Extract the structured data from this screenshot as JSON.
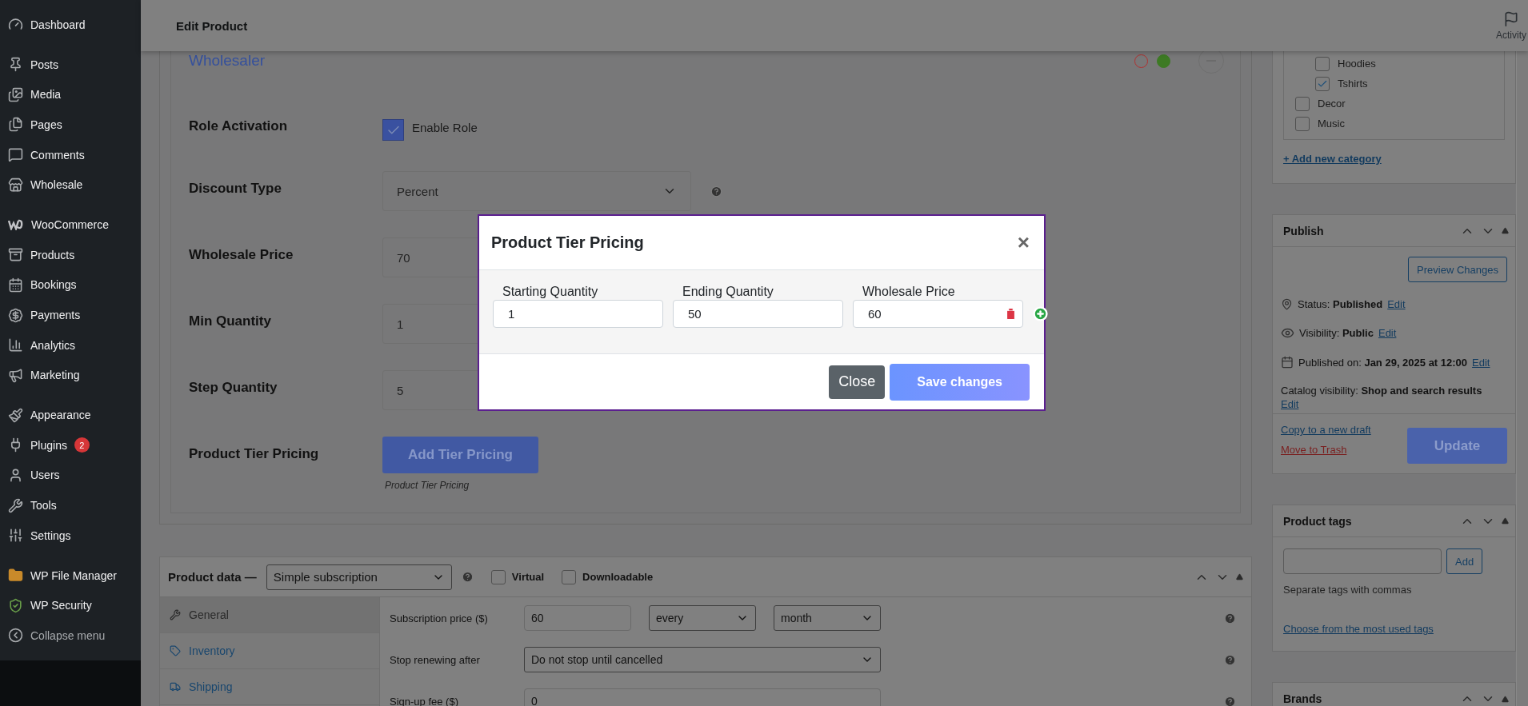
{
  "sidebar": {
    "groups": [
      {
        "items": [
          {
            "label": "Dashboard",
            "kind": "dashboard"
          }
        ]
      },
      {
        "items": [
          {
            "label": "Posts",
            "kind": "posts"
          },
          {
            "label": "Media",
            "kind": "media"
          },
          {
            "label": "Pages",
            "kind": "pages"
          },
          {
            "label": "Comments",
            "kind": "comments"
          },
          {
            "label": "Wholesale",
            "kind": "store"
          }
        ]
      },
      {
        "items": [
          {
            "label": "WooCommerce",
            "kind": "woo"
          },
          {
            "label": "Products",
            "kind": "products"
          },
          {
            "label": "Bookings",
            "kind": "bookings"
          },
          {
            "label": "Payments",
            "kind": "payments"
          },
          {
            "label": "Analytics",
            "kind": "analytics"
          },
          {
            "label": "Marketing",
            "kind": "marketing"
          }
        ]
      },
      {
        "items": [
          {
            "label": "Appearance",
            "kind": "appearance"
          },
          {
            "label": "Plugins",
            "kind": "plugins",
            "badge": "2"
          },
          {
            "label": "Users",
            "kind": "users"
          },
          {
            "label": "Tools",
            "kind": "tools"
          },
          {
            "label": "Settings",
            "kind": "settings"
          }
        ]
      },
      {
        "items": [
          {
            "label": "WP File Manager",
            "kind": "folder"
          },
          {
            "label": "WP Security",
            "kind": "shield"
          },
          {
            "label": "Collapse menu",
            "kind": "collapse"
          }
        ]
      }
    ]
  },
  "header": {
    "title": "Edit Product",
    "activity": "Activity"
  },
  "role_panel": {
    "title": "Wholesaler",
    "status_dots": [
      {
        "color": "#b03030",
        "filled": false
      },
      {
        "color": "#3d7a24",
        "filled": true
      }
    ],
    "rows": [
      {
        "label": "Role Activation",
        "kind": "checkbox",
        "checked": true,
        "text": "Enable Role"
      },
      {
        "label": "Discount Type",
        "kind": "select",
        "value": "Percent",
        "help": true
      },
      {
        "label": "Wholesale Price",
        "kind": "input",
        "value": "70"
      },
      {
        "label": "Min Quantity",
        "kind": "input",
        "value": "1"
      },
      {
        "label": "Step Quantity",
        "kind": "input",
        "value": "5"
      },
      {
        "label": "Product Tier Pricing",
        "kind": "button",
        "text": "Add Tier Pricing",
        "note": "Product Tier Pricing"
      }
    ]
  },
  "modal": {
    "title": "Product Tier Pricing",
    "close": "×",
    "columns": [
      "Starting Quantity",
      "Ending Quantity",
      "Wholesale Price"
    ],
    "tiers": [
      {
        "start": "1",
        "end": "50",
        "price": "60"
      }
    ],
    "buttons": [
      {
        "label": "Close",
        "kind": "secondary"
      },
      {
        "label": "Save changes",
        "kind": "primary"
      }
    ]
  },
  "product_data": {
    "label": "Product data —",
    "type": "Simple subscription",
    "options": [
      {
        "label": "Virtual",
        "checked": false
      },
      {
        "label": "Downloadable",
        "checked": false
      }
    ],
    "tabs": [
      {
        "label": "General",
        "selected": true,
        "kind": "wrench"
      },
      {
        "label": "Inventory",
        "selected": false,
        "kind": "tag"
      },
      {
        "label": "Shipping",
        "selected": false,
        "kind": "truck"
      }
    ],
    "fields": [
      {
        "label": "Subscription price ($)",
        "kind": "price",
        "value": "60",
        "period": "every",
        "interval": "month"
      },
      {
        "label": "Stop renewing after",
        "kind": "select",
        "value": "Do not stop until cancelled"
      },
      {
        "label": "Sign-up fee ($)",
        "kind": "input",
        "value": "0"
      }
    ]
  },
  "categories": {
    "items": [
      {
        "children": [
          {
            "label": "Hoodies",
            "checked": false
          },
          {
            "label": "Tshirts",
            "checked": true
          }
        ]
      },
      {
        "label": "Decor",
        "checked": false
      },
      {
        "label": "Music",
        "checked": false
      }
    ],
    "add_link": "+ Add new category"
  },
  "publish": {
    "title": "Publish",
    "preview": "Preview Changes",
    "lines": [
      {
        "kind": "status",
        "text": "Status: **Published**",
        "link": "Edit"
      },
      {
        "kind": "visibility",
        "text": "Visibility: **Public**",
        "link": "Edit"
      },
      {
        "kind": "date",
        "text": "Published on: **Jan 29, 2025 at 12:00**",
        "link": "Edit"
      },
      {
        "kind": "catalog",
        "text": "Catalog visibility: **Shop and search results**",
        "link": "Edit"
      }
    ],
    "copy_link": "Copy to a new draft",
    "trash_link": "Move to Trash",
    "update": "Update"
  },
  "product_tags": {
    "title": "Product tags",
    "add": "Add",
    "hint": "Separate tags with commas",
    "link": "Choose from the most used tags"
  },
  "brands": {
    "title": "Brands"
  }
}
